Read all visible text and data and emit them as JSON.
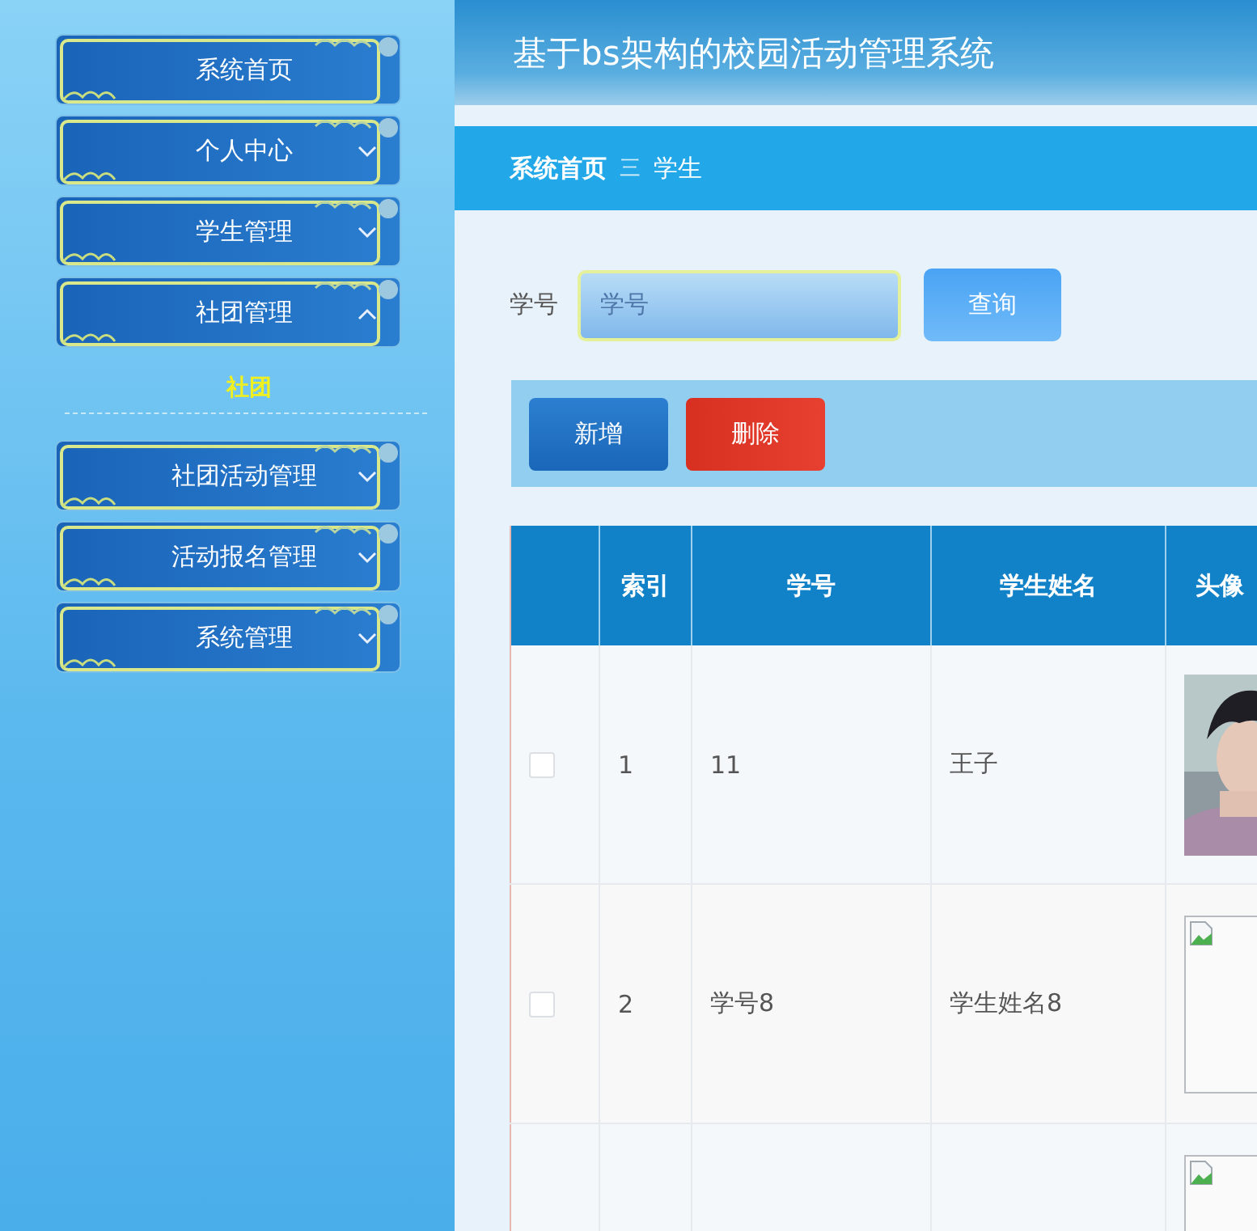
{
  "sidebar": {
    "items": [
      {
        "label": "系统首页",
        "has_caret": false
      },
      {
        "label": "个人中心",
        "has_caret": true,
        "expanded": false
      },
      {
        "label": "学生管理",
        "has_caret": true,
        "expanded": false
      },
      {
        "label": "社团管理",
        "has_caret": true,
        "expanded": true,
        "children": [
          {
            "label": "社团"
          }
        ]
      },
      {
        "label": "社团活动管理",
        "has_caret": true,
        "expanded": false
      },
      {
        "label": "活动报名管理",
        "has_caret": true,
        "expanded": false
      },
      {
        "label": "系统管理",
        "has_caret": true,
        "expanded": false
      }
    ]
  },
  "header": {
    "title": "基于bs架构的校园活动管理系统"
  },
  "breadcrumb": {
    "home": "系统首页",
    "separator": "三",
    "current": "学生"
  },
  "search": {
    "label": "学号",
    "placeholder": "学号",
    "button": "查询"
  },
  "actions": [
    {
      "label": "新增",
      "kind": "add"
    },
    {
      "label": "删除",
      "kind": "delete"
    }
  ],
  "table": {
    "columns": [
      "索引",
      "学号",
      "学生姓名",
      "头像"
    ],
    "rows": [
      {
        "checked": false,
        "index": "1",
        "student_id": "11",
        "name": "王子"
      },
      {
        "checked": false,
        "index": "2",
        "student_id": "学号8",
        "name": "学生姓名8",
        "avatar": {
          "kind": "broken"
        }
      },
      {
        "avatar": {
          "kind": "broken"
        }
      }
    ]
  }
}
